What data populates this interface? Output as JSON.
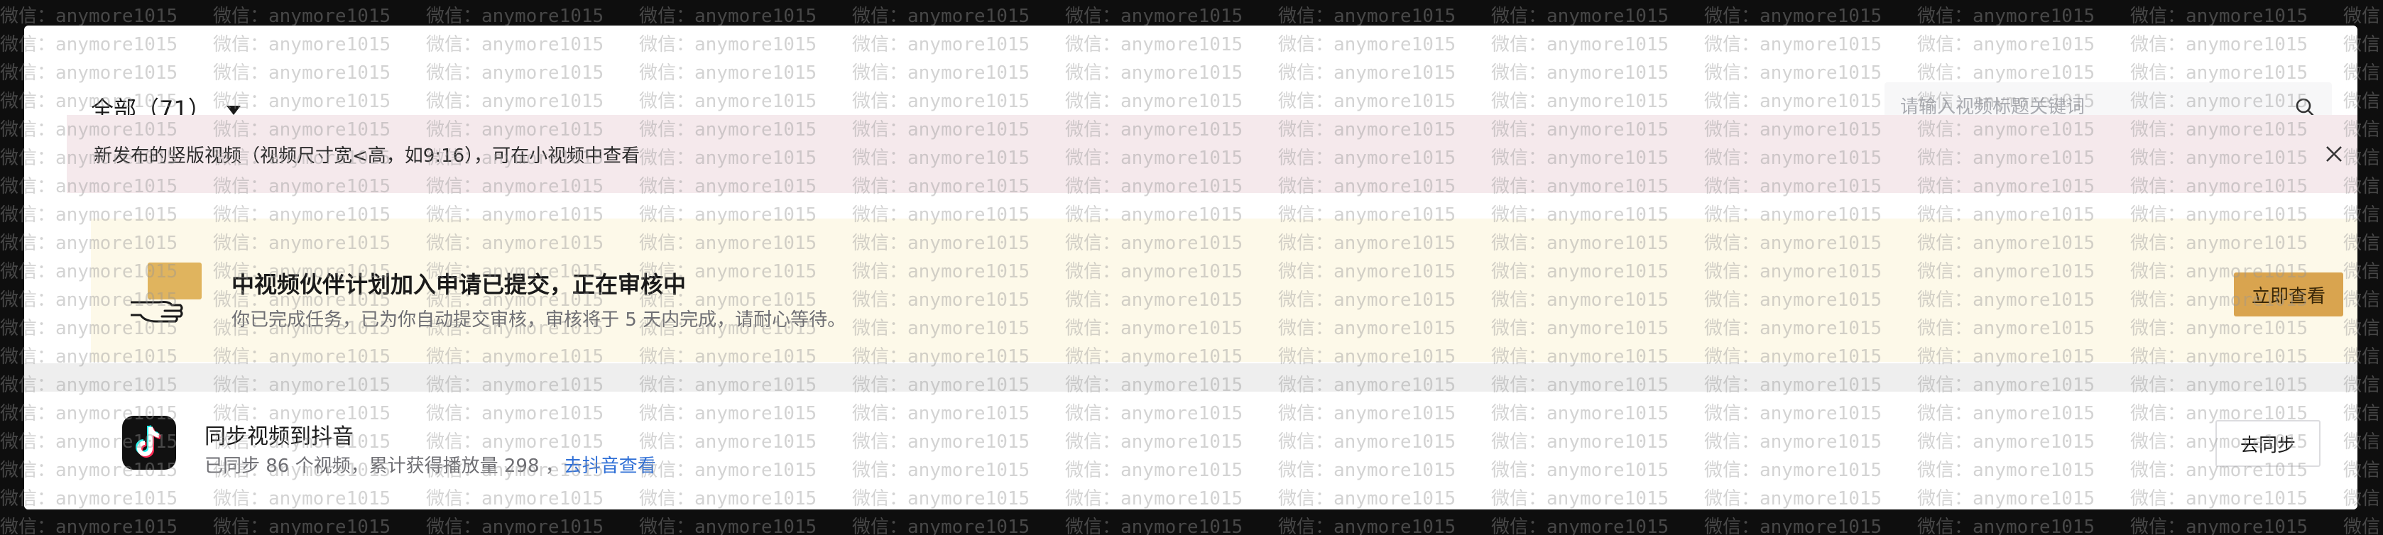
{
  "header": {
    "filter_label": "全部（71）",
    "search_placeholder": "请输入视频标题关键词"
  },
  "notice": {
    "text": "新发布的竖版视频（视频尺寸宽<高，如9:16），可在小视频中查看"
  },
  "partner": {
    "title": "中视频伙伴计划加入申请已提交，正在审核中",
    "description": "你已完成任务，已为你自动提交审核，审核将于 5 天内完成，请耐心等待。",
    "button_label": "立即查看"
  },
  "sync": {
    "title": "同步视频到抖音",
    "stats_text": "已同步 86 个视频，累计获得播放量 298 ，",
    "link_label": "去抖音查看",
    "button_label": "去同步"
  },
  "watermark": {
    "text": "微信：anymore1015"
  },
  "colors": {
    "accent_button": "#d9a44f",
    "notice_bg": "#f5e9ec",
    "partner_bg": "#fdf9e9",
    "link": "#2f6fd6"
  },
  "icons": [
    "caret-down-icon",
    "search-icon",
    "close-icon",
    "hand-illustration-icon",
    "tiktok-logo-icon"
  ]
}
